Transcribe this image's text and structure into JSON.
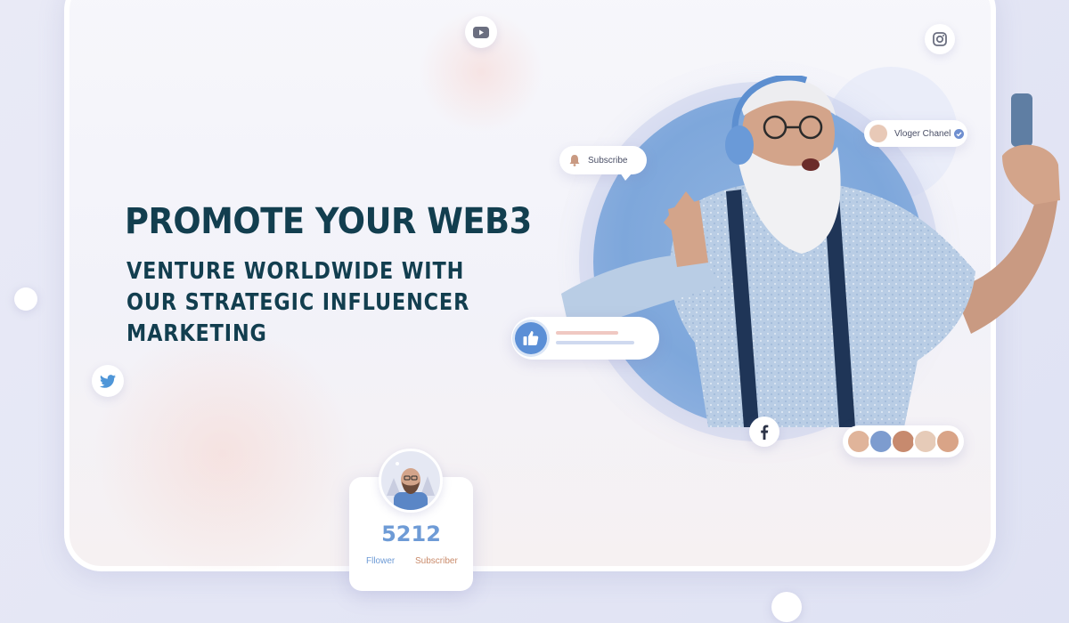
{
  "hero": {
    "headline": "PROMOTE YOUR WEB3",
    "sub_lines": [
      "VENTURE WORLDWIDE WITH",
      "OUR STRATEGIC INFLUENCER",
      "MARKETING"
    ]
  },
  "subscribe_bubble": {
    "label": "Subscribe"
  },
  "vlogger_badge": {
    "label": "Vloger Chanel"
  },
  "profile_card": {
    "count": "5212",
    "follower_label": "Fllower",
    "subscriber_label": "Subscriber"
  },
  "icons": [
    "youtube-icon",
    "instagram-icon",
    "twitter-icon",
    "facebook-icon",
    "bell-icon",
    "thumbs-up-icon",
    "verified-icon"
  ],
  "colors": {
    "headline": "#123e4f",
    "accent_blue": "#5b8fd6",
    "count": "#6e9bd6",
    "subscriber": "#c98a6a"
  }
}
